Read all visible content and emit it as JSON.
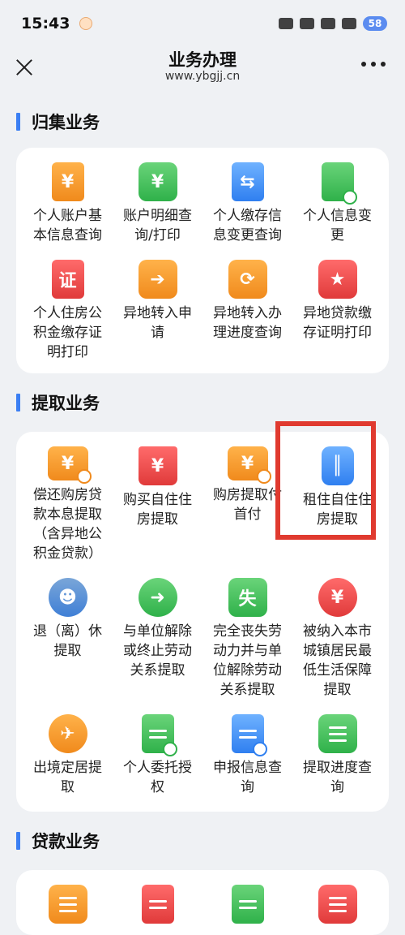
{
  "status": {
    "time": "15:43",
    "battery": "58"
  },
  "nav": {
    "title": "业务办理",
    "subtitle": "www.ybgjj.cn"
  },
  "sections": {
    "guiji": {
      "title": "归集业务",
      "items": [
        {
          "label": "个人账户基本信息查询",
          "icon": "document-yuan-icon",
          "color": "#f08a1c"
        },
        {
          "label": "账户明细查询/打印",
          "icon": "statement-yuan-icon",
          "color": "#2fb14a"
        },
        {
          "label": "个人缴存信息变更查询",
          "icon": "exchange-arrows-icon",
          "color": "#2f7ff0"
        },
        {
          "label": "个人信息变更",
          "icon": "document-exchange-icon",
          "color": "#2fb14a"
        },
        {
          "label": "个人住房公积金缴存证明打印",
          "icon": "certificate-icon",
          "symbol": "证",
          "color": "#e03a3a"
        },
        {
          "label": "异地转入申请",
          "icon": "transfer-in-arrow-icon",
          "color": "#f08a1c"
        },
        {
          "label": "异地转入办理进度查询",
          "icon": "transfer-progress-icon",
          "color": "#f08a1c"
        },
        {
          "label": "异地贷款缴存证明打印",
          "icon": "star-certificate-icon",
          "color": "#e03a3a"
        }
      ]
    },
    "tiqu": {
      "title": "提取业务",
      "items": [
        {
          "label": "偿还购房贷款本息提取（含异地公积金贷款）",
          "icon": "wallet-yuan-icon",
          "color": "#f08a1c"
        },
        {
          "label": "购买自住住房提取",
          "icon": "house-yuan-icon",
          "color": "#e03a3a"
        },
        {
          "label": "购房提取付首付",
          "icon": "wallet-yuan-icon",
          "color": "#f08a1c"
        },
        {
          "label": "租住自住住房提取",
          "icon": "suitcase-icon",
          "color": "#2f7ff0"
        },
        {
          "label": "退（离）休提取",
          "icon": "elderly-person-icon",
          "color": "#2f7ff0"
        },
        {
          "label": "与单位解除或终止劳动关系提取",
          "icon": "person-arrow-icon",
          "color": "#2fb14a"
        },
        {
          "label": "完全丧失劳动力并与单位解除劳动关系提取",
          "icon": "briefcase-icon",
          "symbol": "失",
          "color": "#2fb14a"
        },
        {
          "label": "被纳入本市城镇居民最低生活保障提取",
          "icon": "money-bag-icon",
          "color": "#e03a3a"
        },
        {
          "label": "出境定居提取",
          "icon": "airplane-icon",
          "color": "#f08a1c"
        },
        {
          "label": "个人委托授权",
          "icon": "document-person-icon",
          "color": "#2fb14a"
        },
        {
          "label": "申报信息查询",
          "icon": "document-clock-icon",
          "color": "#2f7ff0"
        },
        {
          "label": "提取进度查询",
          "icon": "list-icon",
          "color": "#2fb14a"
        }
      ]
    },
    "daikuan": {
      "title": "贷款业务"
    }
  },
  "highlight_color": "#e03a2f"
}
